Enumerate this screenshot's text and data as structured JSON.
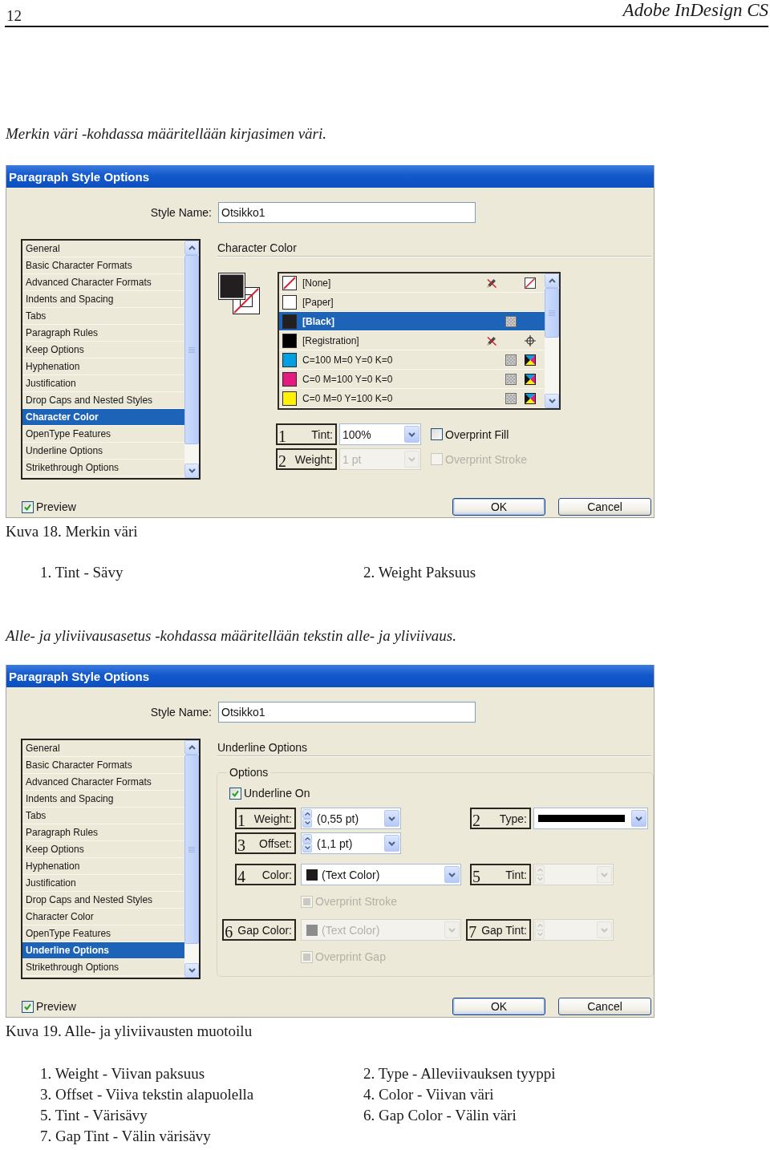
{
  "header": {
    "page_number": "12",
    "book_title": "Adobe InDesign CS"
  },
  "sections": [
    {
      "intro": "Merkin väri -kohdassa määritellään kirjasimen väri.",
      "dialog": {
        "title": "Paragraph Style Options",
        "style_name": {
          "label": "Style Name:",
          "value": "Otsikko1"
        },
        "categories": [
          {
            "label": "General",
            "selected": false
          },
          {
            "label": "Basic Character Formats",
            "selected": false
          },
          {
            "label": "Advanced Character Formats",
            "selected": false
          },
          {
            "label": "Indents and Spacing",
            "selected": false
          },
          {
            "label": "Tabs",
            "selected": false
          },
          {
            "label": "Paragraph Rules",
            "selected": false
          },
          {
            "label": "Keep Options",
            "selected": false
          },
          {
            "label": "Hyphenation",
            "selected": false
          },
          {
            "label": "Justification",
            "selected": false
          },
          {
            "label": "Drop Caps and Nested Styles",
            "selected": false
          },
          {
            "label": "Character Color",
            "selected": true
          },
          {
            "label": "OpenType Features",
            "selected": false
          },
          {
            "label": "Underline Options",
            "selected": false
          },
          {
            "label": "Strikethrough Options",
            "selected": false
          }
        ],
        "panel": {
          "kind": "character_color",
          "title": "Character Color",
          "swatches": [
            {
              "name": "[None]",
              "kind": "none",
              "selected": false,
              "locked": true,
              "process": false
            },
            {
              "name": "[Paper]",
              "kind": "paper",
              "color": "#ffffff",
              "selected": false,
              "locked": false,
              "process": false
            },
            {
              "name": "[Black]",
              "kind": "black",
              "color": "#231f20",
              "selected": true,
              "locked": false,
              "process": true
            },
            {
              "name": "[Registration]",
              "kind": "registration",
              "color": "#000000",
              "selected": false,
              "locked": true,
              "process": false
            },
            {
              "name": "C=100 M=0 Y=0 K=0",
              "kind": "cmyk",
              "color": "#00a0e3",
              "selected": false,
              "locked": false,
              "process": true
            },
            {
              "name": "C=0 M=100 Y=0 K=0",
              "kind": "cmyk",
              "color": "#e5197f",
              "selected": false,
              "locked": false,
              "process": true
            },
            {
              "name": "C=0 M=0 Y=100 K=0",
              "kind": "cmyk",
              "color": "#fff100",
              "selected": false,
              "locked": false,
              "process": true
            }
          ],
          "rows": [
            {
              "controls": [
                {
                  "kind": "combo",
                  "callout": "1",
                  "label": "Tint:",
                  "value": "100%",
                  "disabled": false
                },
                {
                  "kind": "checkbox",
                  "label": "Overprint Fill",
                  "checked": false,
                  "indeterminate": false,
                  "disabled": false
                }
              ]
            },
            {
              "controls": [
                {
                  "kind": "combo",
                  "callout": "2",
                  "label": "Weight:",
                  "value": "1 pt",
                  "disabled": true
                },
                {
                  "kind": "checkbox",
                  "label": "Overprint Stroke",
                  "checked": false,
                  "indeterminate": false,
                  "disabled": true
                }
              ]
            }
          ]
        },
        "preview": {
          "label": "Preview",
          "checked": true
        },
        "buttons": [
          {
            "label": "OK",
            "kind": "ok"
          },
          {
            "label": "Cancel",
            "kind": "cancel"
          }
        ]
      },
      "caption": "Kuva 18. Merkin väri",
      "notes": [
        "1. Tint - Sävy",
        "2. Weight Paksuus"
      ]
    },
    {
      "intro": "Alle- ja yliviivausasetus -kohdassa määritellään tekstin alle- ja yliviivaus.",
      "dialog": {
        "title": "Paragraph Style Options",
        "style_name": {
          "label": "Style Name:",
          "value": "Otsikko1"
        },
        "categories": [
          {
            "label": "General",
            "selected": false
          },
          {
            "label": "Basic Character Formats",
            "selected": false
          },
          {
            "label": "Advanced Character Formats",
            "selected": false
          },
          {
            "label": "Indents and Spacing",
            "selected": false
          },
          {
            "label": "Tabs",
            "selected": false
          },
          {
            "label": "Paragraph Rules",
            "selected": false
          },
          {
            "label": "Keep Options",
            "selected": false
          },
          {
            "label": "Hyphenation",
            "selected": false
          },
          {
            "label": "Justification",
            "selected": false
          },
          {
            "label": "Drop Caps and Nested Styles",
            "selected": false
          },
          {
            "label": "Character Color",
            "selected": false
          },
          {
            "label": "OpenType Features",
            "selected": false
          },
          {
            "label": "Underline Options",
            "selected": true
          },
          {
            "label": "Strikethrough Options",
            "selected": false
          }
        ],
        "panel": {
          "kind": "underline_options",
          "title": "Underline Options",
          "group_label": "Options",
          "toggle": {
            "label": "Underline On",
            "checked": true
          },
          "rows": [
            {
              "controls": [
                {
                  "kind": "spin_combo",
                  "callout": "1",
                  "label": "Weight:",
                  "value": "(0,55 pt)",
                  "disabled": false
                },
                {
                  "kind": "line_combo",
                  "callout": "2",
                  "label": "Type:",
                  "disabled": false
                }
              ]
            },
            {
              "controls": [
                {
                  "kind": "spin_combo",
                  "callout": "3",
                  "label": "Offset:",
                  "value": "(1,1 pt)",
                  "disabled": false
                }
              ]
            },
            {
              "controls": [
                {
                  "kind": "color_combo",
                  "callout": "4",
                  "label": "Color:",
                  "value": "(Text Color)",
                  "disabled": false
                },
                {
                  "kind": "spin_combo",
                  "callout": "5",
                  "label": "Tint:",
                  "disabled": true
                }
              ]
            },
            {
              "controls": [
                {
                  "kind": "checkbox",
                  "label": "Overprint Stroke",
                  "checked": false,
                  "indeterminate": true,
                  "disabled": true
                }
              ]
            },
            {
              "controls": [
                {
                  "kind": "color_combo",
                  "callout": "6",
                  "label": "Gap Color:",
                  "value": "(Text Color)",
                  "disabled": true
                },
                {
                  "kind": "spin_combo",
                  "callout": "7",
                  "label": "Gap Tint:",
                  "disabled": true
                }
              ]
            },
            {
              "controls": [
                {
                  "kind": "checkbox",
                  "label": "Overprint Gap",
                  "checked": false,
                  "indeterminate": true,
                  "disabled": true
                }
              ]
            }
          ]
        },
        "preview": {
          "label": "Preview",
          "checked": true
        },
        "buttons": [
          {
            "label": "OK",
            "kind": "ok"
          },
          {
            "label": "Cancel",
            "kind": "cancel"
          }
        ]
      },
      "caption": "Kuva 19. Alle- ja yliviivausten muotoilu",
      "notes": [
        "1. Weight - Viivan paksuus",
        "2. Type - Alleviivauksen tyyppi",
        "3. Offset - Viiva tekstin alapuolella",
        "4. Color - Viivan väri",
        "5. Tint - Värisävy",
        "6. Gap Color - Välin väri",
        "7. Gap Tint - Välin värisävy"
      ]
    }
  ]
}
